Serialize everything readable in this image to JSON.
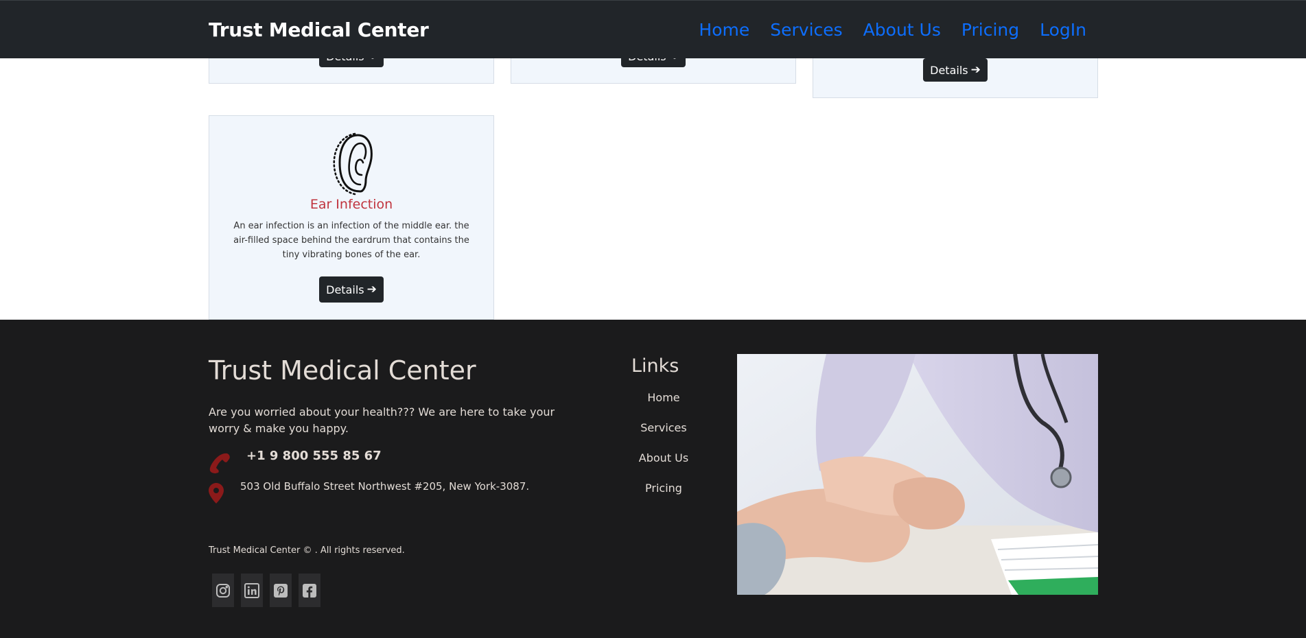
{
  "navbar": {
    "brand": "Trust Medical Center",
    "links": [
      "Home",
      "Services",
      "About Us",
      "Pricing",
      "LogIn"
    ]
  },
  "cards": {
    "details_label": "Details",
    "ear": {
      "title": "Ear Infection",
      "description": "An ear infection is an infection of the middle ear. the air-filled space behind the eardrum that contains the tiny vibrating bones of the ear."
    }
  },
  "footer": {
    "title": "Trust Medical Center",
    "description": "Are you worried about your health??? We are here to take your worry & make you happy.",
    "phone": "+1 9 800 555 85 67",
    "address": "503 Old Buffalo Street Northwest #205, New York-3087.",
    "copyright": "Trust Medical Center © . All rights reserved.",
    "links_title": "Links",
    "links": [
      "Home",
      "Services",
      "About Us",
      "Pricing"
    ],
    "socials": [
      "instagram-icon",
      "linkedin-icon",
      "pinterest-icon",
      "facebook-icon"
    ]
  },
  "colors": {
    "navbar_bg": "#212529",
    "nav_link": "#0d6efd",
    "card_title": "#c0343e",
    "footer_bg": "#1b1b1c",
    "icon_red": "#8b1a1a"
  }
}
